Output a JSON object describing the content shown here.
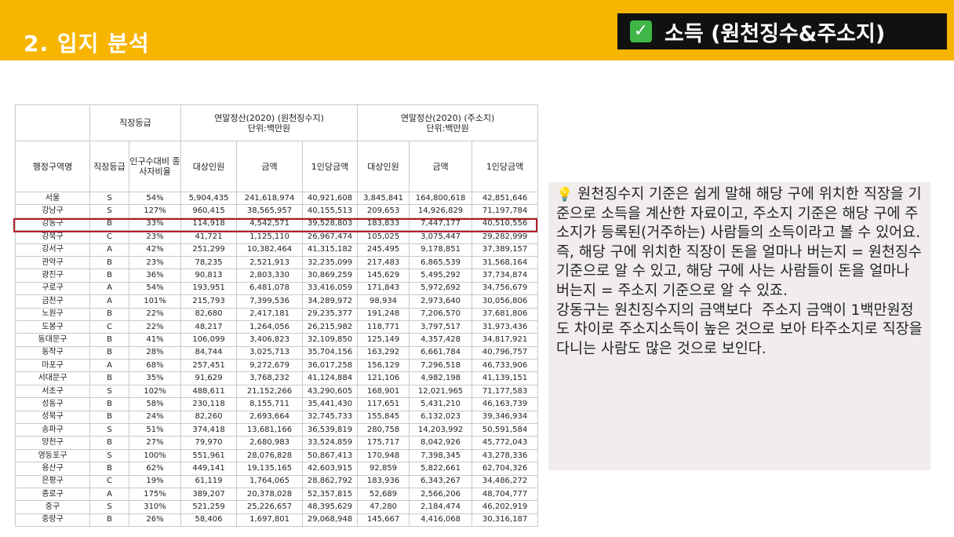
{
  "header": {
    "title": "2. 입지 분석",
    "badge_label": "소득 (원천징수&주소지)"
  },
  "table": {
    "group_headers": {
      "grade_group": "직장등급",
      "withholding_line1": "연말정산(2020) (원천징수지)",
      "withholding_line2": "단위:백만원",
      "address_line1": "연말정산(2020) (주소지)",
      "address_line2": "단위:백만원"
    },
    "columns": [
      "행정구역명",
      "직장등급",
      "인구수대비 종사자비율",
      "대상인원",
      "금액",
      "1인당금액",
      "대상인원",
      "금액",
      "1인당금액"
    ],
    "rows": [
      [
        "서울",
        "S",
        "54%",
        "5,904,435",
        "241,618,974",
        "40,921,608",
        "3,845,841",
        "164,800,618",
        "42,851,646"
      ],
      [
        "강남구",
        "S",
        "127%",
        "960,415",
        "38,565,957",
        "40,155,513",
        "209,653",
        "14,926,829",
        "71,197,784"
      ],
      [
        "강동구",
        "B",
        "33%",
        "114,918",
        "4,542,571",
        "39,528,803",
        "183,833",
        "7,447,177",
        "40,510,556"
      ],
      [
        "강북구",
        "C",
        "23%",
        "41,721",
        "1,125,110",
        "26,967,474",
        "105,025",
        "3,075,447",
        "29,282,999"
      ],
      [
        "강서구",
        "A",
        "42%",
        "251,299",
        "10,382,464",
        "41,315,182",
        "245,495",
        "9,178,851",
        "37,389,157"
      ],
      [
        "관악구",
        "B",
        "23%",
        "78,235",
        "2,521,913",
        "32,235,099",
        "217,483",
        "6,865,539",
        "31,568,164"
      ],
      [
        "광진구",
        "B",
        "36%",
        "90,813",
        "2,803,330",
        "30,869,259",
        "145,629",
        "5,495,292",
        "37,734,874"
      ],
      [
        "구로구",
        "A",
        "54%",
        "193,951",
        "6,481,078",
        "33,416,059",
        "171,843",
        "5,972,692",
        "34,756,679"
      ],
      [
        "금천구",
        "A",
        "101%",
        "215,793",
        "7,399,536",
        "34,289,972",
        "98,934",
        "2,973,640",
        "30,056,806"
      ],
      [
        "노원구",
        "B",
        "22%",
        "82,680",
        "2,417,181",
        "29,235,377",
        "191,248",
        "7,206,570",
        "37,681,806"
      ],
      [
        "도봉구",
        "C",
        "22%",
        "48,217",
        "1,264,056",
        "26,215,982",
        "118,771",
        "3,797,517",
        "31,973,436"
      ],
      [
        "동대문구",
        "B",
        "41%",
        "106,099",
        "3,406,823",
        "32,109,850",
        "125,149",
        "4,357,428",
        "34,817,921"
      ],
      [
        "동작구",
        "B",
        "28%",
        "84,744",
        "3,025,713",
        "35,704,156",
        "163,292",
        "6,661,784",
        "40,796,757"
      ],
      [
        "마포구",
        "A",
        "68%",
        "257,451",
        "9,272,679",
        "36,017,258",
        "156,129",
        "7,296,518",
        "46,733,906"
      ],
      [
        "서대문구",
        "B",
        "35%",
        "91,629",
        "3,768,232",
        "41,124,884",
        "121,106",
        "4,982,198",
        "41,139,151"
      ],
      [
        "서초구",
        "S",
        "102%",
        "488,611",
        "21,152,266",
        "43,290,605",
        "168,901",
        "12,021,965",
        "71,177,583"
      ],
      [
        "성동구",
        "B",
        "58%",
        "230,118",
        "8,155,711",
        "35,441,430",
        "117,651",
        "5,431,210",
        "46,163,739"
      ],
      [
        "성북구",
        "B",
        "24%",
        "82,260",
        "2,693,664",
        "32,745,733",
        "155,845",
        "6,132,023",
        "39,346,934"
      ],
      [
        "송파구",
        "S",
        "51%",
        "374,418",
        "13,681,166",
        "36,539,819",
        "280,758",
        "14,203,992",
        "50,591,584"
      ],
      [
        "양천구",
        "B",
        "27%",
        "79,970",
        "2,680,983",
        "33,524,859",
        "175,717",
        "8,042,926",
        "45,772,043"
      ],
      [
        "영등포구",
        "S",
        "100%",
        "551,961",
        "28,076,828",
        "50,867,413",
        "170,948",
        "7,398,345",
        "43,278,336"
      ],
      [
        "용산구",
        "B",
        "62%",
        "449,141",
        "19,135,165",
        "42,603,915",
        "92,859",
        "5,822,661",
        "62,704,326"
      ],
      [
        "은평구",
        "C",
        "19%",
        "61,119",
        "1,764,065",
        "28,862,792",
        "183,936",
        "6,343,267",
        "34,486,272"
      ],
      [
        "종로구",
        "A",
        "175%",
        "389,207",
        "20,378,028",
        "52,357,815",
        "52,689",
        "2,566,206",
        "48,704,777"
      ],
      [
        "중구",
        "S",
        "310%",
        "521,259",
        "25,226,657",
        "48,395,629",
        "47,280",
        "2,184,474",
        "46,202,919"
      ],
      [
        "중랑구",
        "B",
        "26%",
        "58,406",
        "1,697,801",
        "29,068,948",
        "145,667",
        "4,416,068",
        "30,316,187"
      ]
    ],
    "highlighted_row": "강동구",
    "highlight_color": "#b01f24"
  },
  "note": {
    "icon": "lightbulb-icon",
    "text": "원천징수지 기준은 쉽게 말해 해당 구에 위치한 직장을 기준으로 소득을 계산한 자료이고, 주소지 기준은 해당 구에 주소지가 등록된(거주하는) 사람들의 소득이라고 볼 수 있어요.\n즉, 해당 구에 위치한 직장이 돈을 얼마나 버는지 = 원천징수 기준으로 알 수 있고, 해당 구에 사는 사람들이 돈을 얼마나 버는지 = 주소지 기준으로 알 수 있죠.\n강동구는 원친징수지의 금액보다  주소지 금액이 1백만원정도 차이로 주소지소득이 높은 것으로 보아 타주소지로 직장을 다니는 사람도 많은 것으로 보인다."
  },
  "colors": {
    "accent": "#f7b500",
    "badge_bg": "#111111",
    "note_bg": "#f1eded"
  }
}
